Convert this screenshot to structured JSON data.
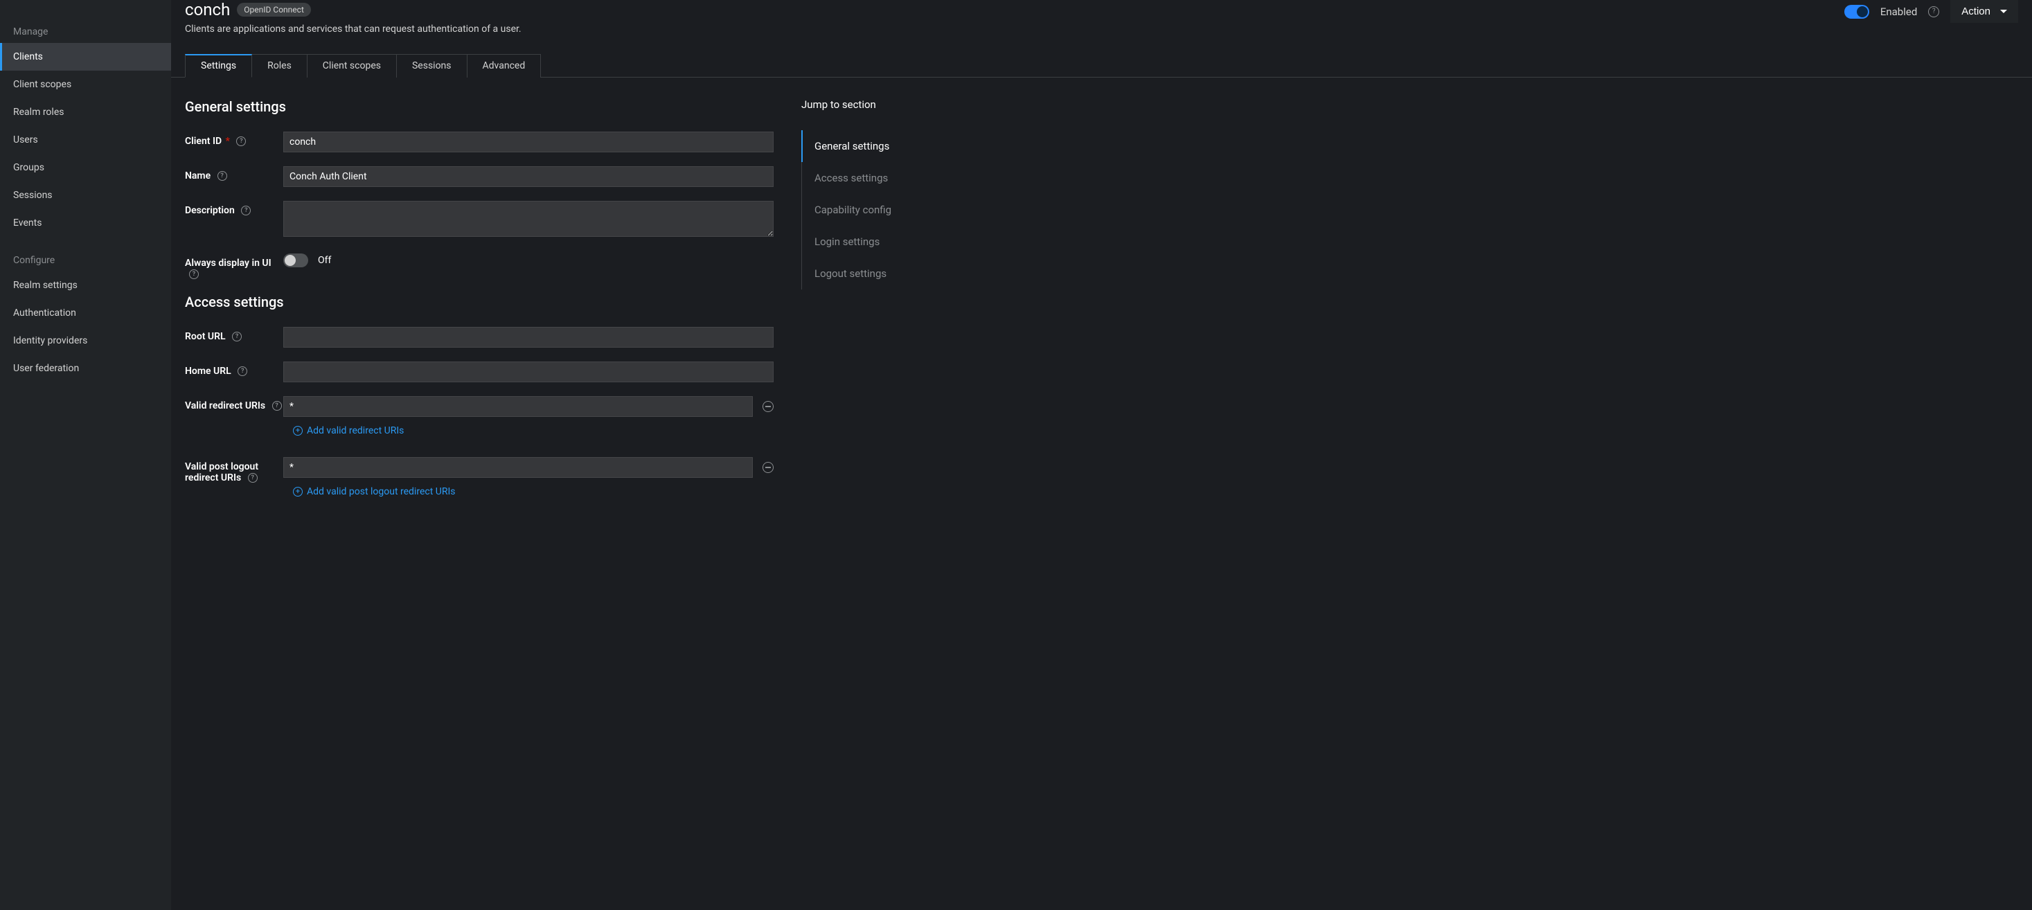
{
  "sidebar": {
    "sections": [
      {
        "header": "Manage",
        "items": [
          {
            "label": "Clients",
            "active": true
          },
          {
            "label": "Client scopes"
          },
          {
            "label": "Realm roles"
          },
          {
            "label": "Users"
          },
          {
            "label": "Groups"
          },
          {
            "label": "Sessions"
          },
          {
            "label": "Events"
          }
        ]
      },
      {
        "header": "Configure",
        "items": [
          {
            "label": "Realm settings"
          },
          {
            "label": "Authentication"
          },
          {
            "label": "Identity providers"
          },
          {
            "label": "User federation"
          }
        ]
      }
    ]
  },
  "header": {
    "title": "conch",
    "badge": "OpenID Connect",
    "subtitle": "Clients are applications and services that can request authentication of a user.",
    "enabled_label": "Enabled",
    "action_label": "Action"
  },
  "tabs": [
    {
      "label": "Settings",
      "active": true
    },
    {
      "label": "Roles"
    },
    {
      "label": "Client scopes"
    },
    {
      "label": "Sessions"
    },
    {
      "label": "Advanced"
    }
  ],
  "sections": {
    "general_title": "General settings",
    "access_title": "Access settings"
  },
  "fields": {
    "client_id": {
      "label": "Client ID",
      "value": "conch",
      "required": true
    },
    "name": {
      "label": "Name",
      "value": "Conch Auth Client"
    },
    "description": {
      "label": "Description",
      "value": ""
    },
    "always_display": {
      "label": "Always display in UI",
      "state_label": "Off"
    },
    "root_url": {
      "label": "Root URL",
      "value": ""
    },
    "home_url": {
      "label": "Home URL",
      "value": ""
    },
    "redirect_uris": {
      "label": "Valid redirect URIs",
      "values": [
        "*"
      ],
      "add_label": "Add valid redirect URIs"
    },
    "post_logout_uris": {
      "label": "Valid post logout redirect URIs",
      "values": [
        "*"
      ],
      "add_label": "Add valid post logout redirect URIs"
    }
  },
  "jump_nav": {
    "title": "Jump to section",
    "items": [
      {
        "label": "General settings",
        "active": true
      },
      {
        "label": "Access settings"
      },
      {
        "label": "Capability config"
      },
      {
        "label": "Login settings"
      },
      {
        "label": "Logout settings"
      }
    ]
  }
}
